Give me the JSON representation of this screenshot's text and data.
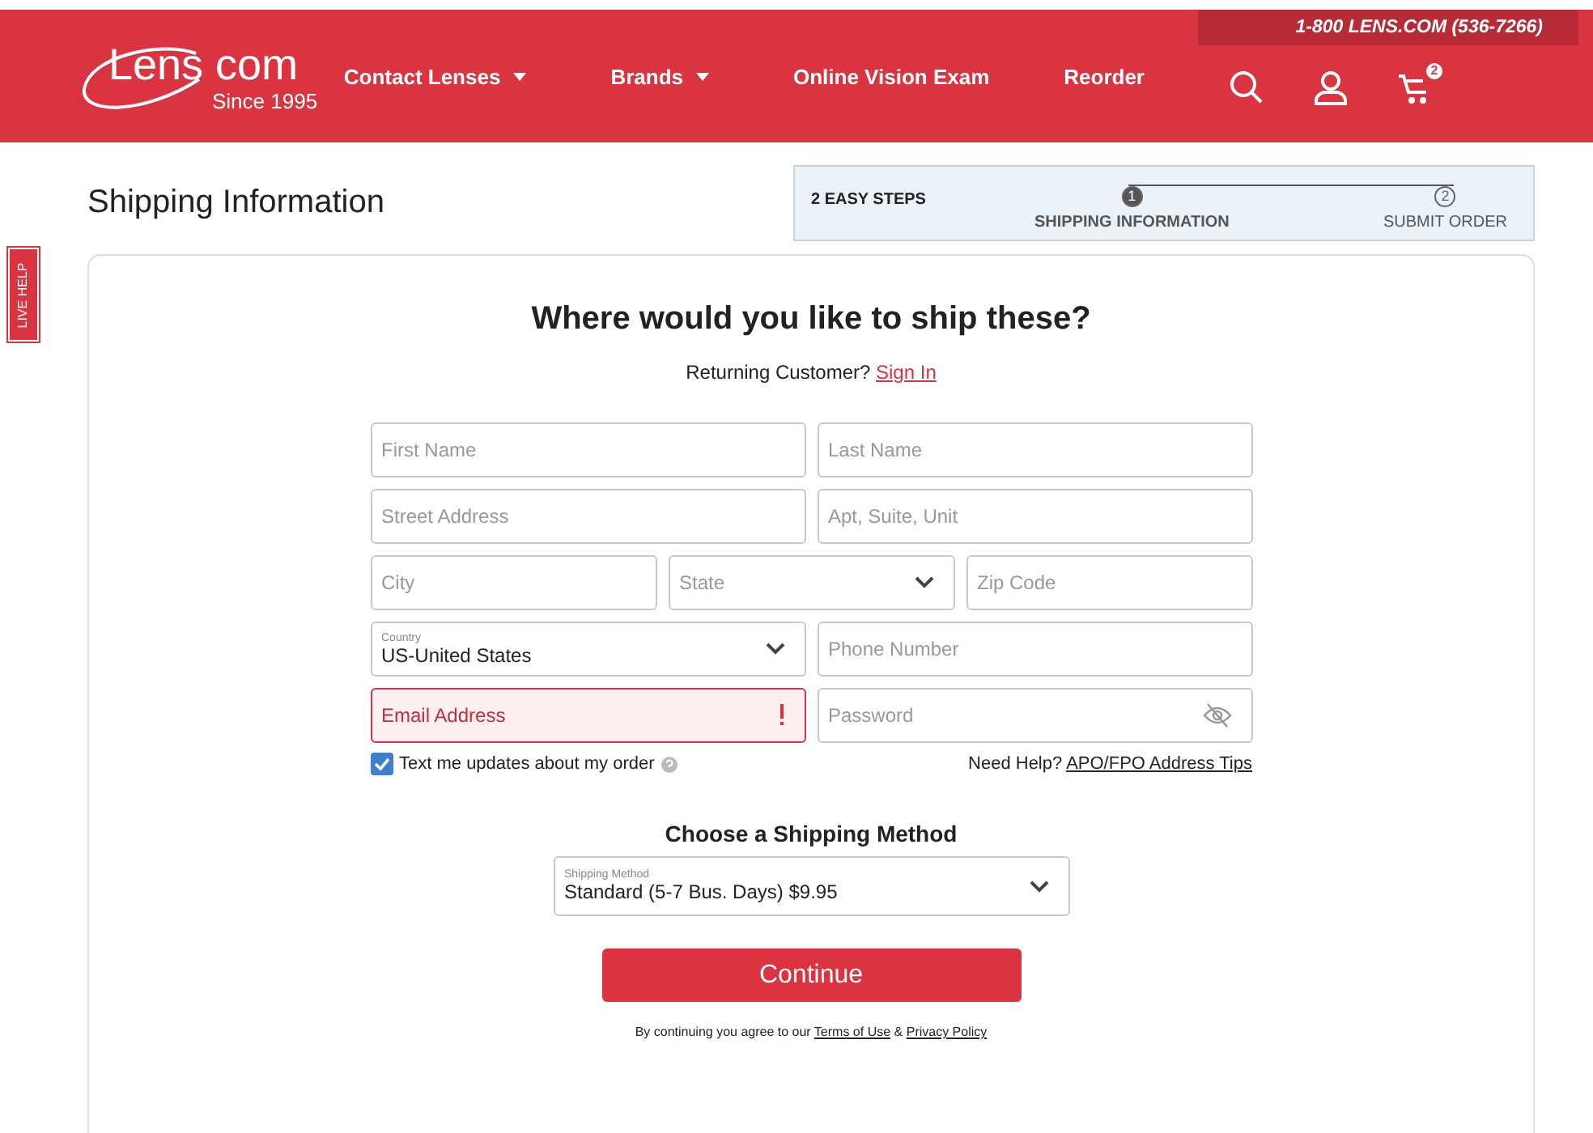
{
  "header": {
    "logo": {
      "word": "Lens",
      "suffix": "com",
      "tagline": "Since 1995"
    },
    "phone": "1-800 LENS.COM (536-7266)",
    "nav": [
      {
        "label": "Contact Lenses",
        "has_caret": true
      },
      {
        "label": "Brands",
        "has_caret": true
      },
      {
        "label": "Online Vision Exam",
        "has_caret": false
      },
      {
        "label": "Reorder",
        "has_caret": false
      }
    ],
    "cart_count": "2"
  },
  "live_help": "LIVE HELP",
  "page_title": "Shipping Information",
  "steps": {
    "label": "2 EASY STEPS",
    "items": [
      {
        "number": "1",
        "label": "SHIPPING INFORMATION",
        "selected": true
      },
      {
        "number": "2",
        "label": "SUBMIT ORDER",
        "selected": false
      }
    ]
  },
  "form": {
    "heading": "Where would you like to ship these?",
    "returning": {
      "text": "Returning Customer?",
      "link": "Sign In"
    },
    "rows": [
      [
        {
          "kind": "text",
          "placeholder": "First Name",
          "error": false
        },
        {
          "kind": "text",
          "placeholder": "Last Name",
          "error": false
        }
      ],
      [
        {
          "kind": "text",
          "placeholder": "Street Address",
          "error": false
        },
        {
          "kind": "text",
          "placeholder": "Apt, Suite, Unit",
          "error": false
        }
      ],
      [
        {
          "kind": "text",
          "placeholder": "City",
          "error": false
        },
        {
          "kind": "select",
          "placeholder": "State",
          "error": false
        },
        {
          "kind": "text",
          "placeholder": "Zip Code",
          "error": false
        }
      ],
      [
        {
          "kind": "select",
          "label": "Country",
          "value": "US-United States",
          "error": false
        },
        {
          "kind": "text",
          "placeholder": "Phone Number",
          "error": false
        }
      ],
      [
        {
          "kind": "text",
          "placeholder": "Email Address",
          "error": true
        },
        {
          "kind": "password",
          "placeholder": "Password",
          "error": false
        }
      ]
    ],
    "sms": {
      "label": "Text me updates about my order",
      "checked": true
    },
    "help": {
      "text": "Need Help?",
      "link": "APO/FPO Address Tips"
    },
    "shipping_heading": "Choose a Shipping Method",
    "shipping": {
      "label": "Shipping Method",
      "value": "Standard (5-7 Bus. Days) $9.95"
    },
    "button": "Continue",
    "legal": {
      "text": "By continuing you agree to our",
      "link1": "Terms of Use",
      "and": "&",
      "link2": "Privacy Policy"
    }
  }
}
